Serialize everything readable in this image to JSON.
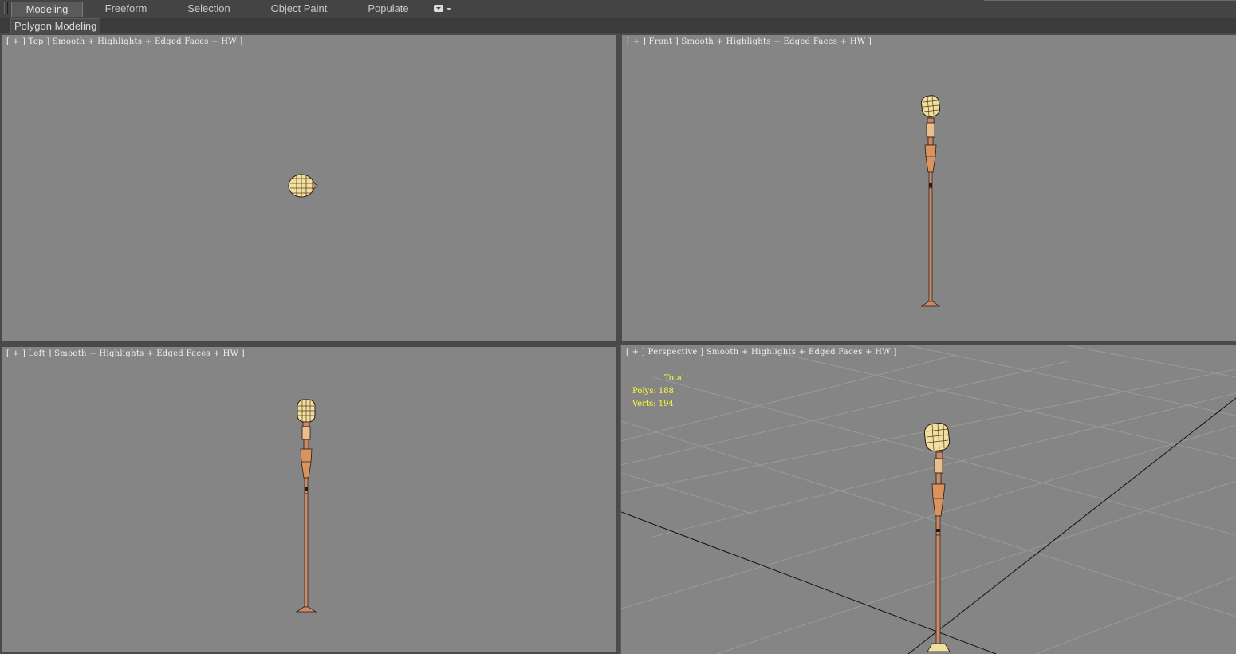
{
  "ribbon": {
    "tabs": [
      "Modeling",
      "Freeform",
      "Selection",
      "Object Paint",
      "Populate"
    ],
    "active_tab": "Modeling",
    "panel_label": "Polygon Modeling"
  },
  "viewports": {
    "top": {
      "label": "[ + ] Top ] Smooth + Highlights + Edged Faces + HW ]"
    },
    "front": {
      "label": "[ + ] Front ] Smooth + Highlights + Edged Faces + HW ]"
    },
    "left": {
      "label": "[ + ] Left ] Smooth + Highlights + Edged Faces + HW ]"
    },
    "perspective": {
      "label": "[ + ] Perspective ] Smooth + Highlights + Edged Faces + HW ]",
      "stats": {
        "total_label": "Total",
        "polys": "Polys: 188",
        "verts": "Verts: 194"
      }
    }
  },
  "colors": {
    "viewport_bg": "#858585",
    "model_body": "#c98a68",
    "model_highlight": "#f0e0a0",
    "stats_text": "#ffff33"
  }
}
